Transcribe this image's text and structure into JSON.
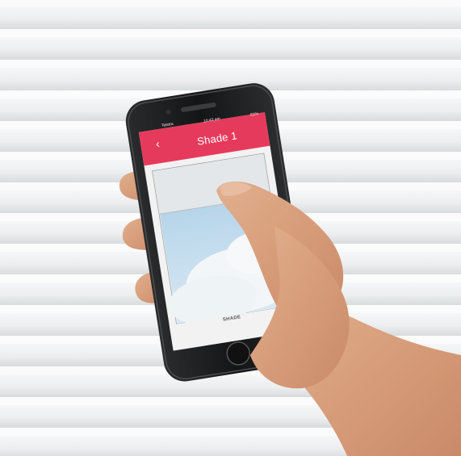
{
  "status_bar": {
    "carrier": "Telstra",
    "time": "10:43 am",
    "battery": "81%"
  },
  "app": {
    "title": "Shade 1",
    "back_icon": "chevron-left-icon",
    "accent_color": "#e63a5c"
  },
  "shade_control": {
    "label": "SHADE",
    "shade_position_fraction": 0.28
  }
}
